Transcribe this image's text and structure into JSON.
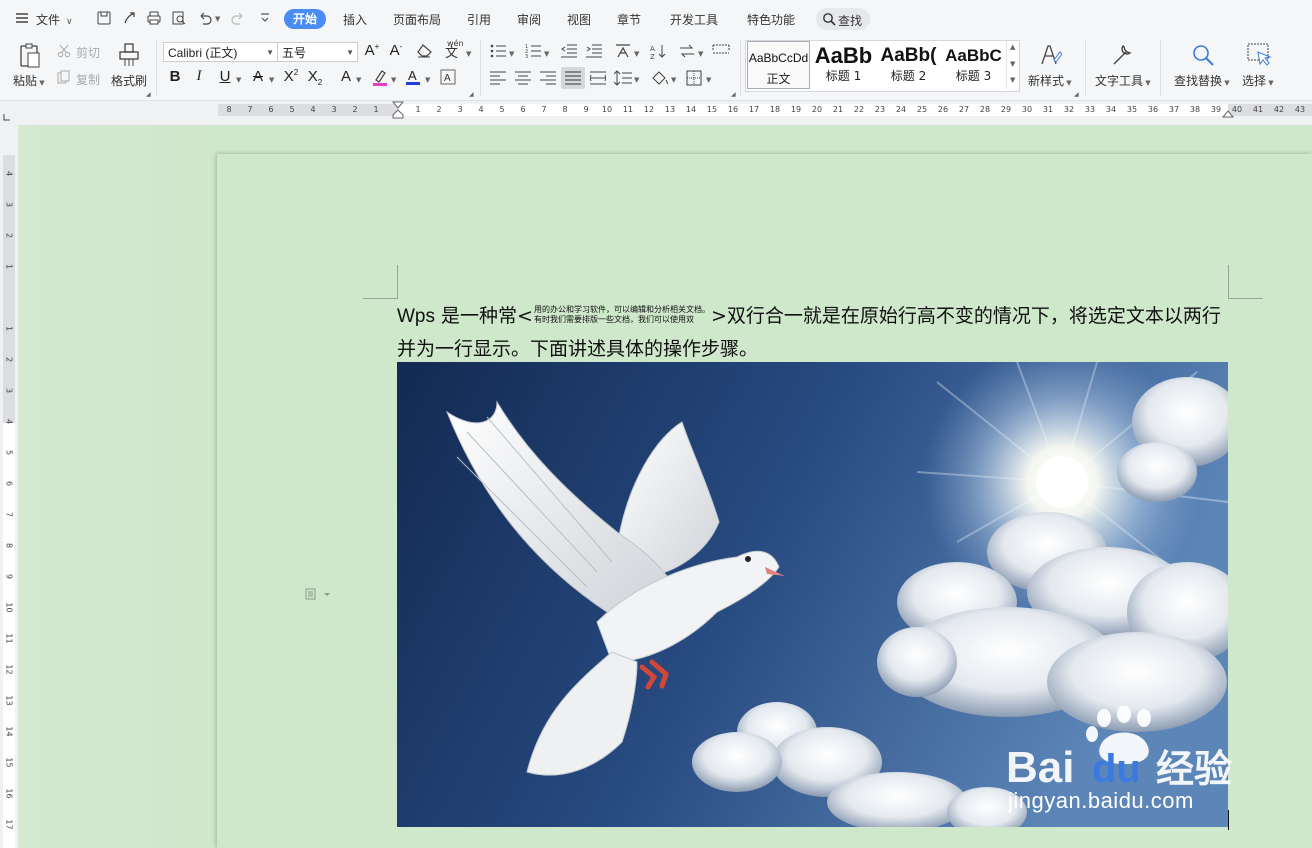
{
  "menubar": {
    "file_label": "文件",
    "tabs": [
      {
        "id": "home",
        "label": "开始",
        "active": true
      },
      {
        "id": "insert",
        "label": "插入"
      },
      {
        "id": "layout",
        "label": "页面布局"
      },
      {
        "id": "references",
        "label": "引用"
      },
      {
        "id": "review",
        "label": "审阅"
      },
      {
        "id": "view",
        "label": "视图"
      },
      {
        "id": "chapter",
        "label": "章节"
      },
      {
        "id": "dev",
        "label": "开发工具"
      },
      {
        "id": "special",
        "label": "特色功能"
      }
    ],
    "search_label": "查找",
    "accent": "#4a8cf3"
  },
  "ribbon": {
    "paste": "粘贴",
    "cut": "剪切",
    "copy": "复制",
    "format_painter": "格式刷",
    "font_name": "Calibri (正文)",
    "font_size": "五号",
    "styles": [
      {
        "preview": "AaBbCcDd",
        "name": "正文"
      },
      {
        "preview": "AaBb",
        "name": "标题 1"
      },
      {
        "preview": "AaBb(",
        "name": "标题 2"
      },
      {
        "preview": "AaBbC",
        "name": "标题 3"
      }
    ],
    "new_style": "新样式",
    "text_tools": "文字工具",
    "find_replace": "查找替换",
    "select": "选择"
  },
  "ruler": {
    "h_numbers": [
      "8",
      "7",
      "6",
      "5",
      "4",
      "3",
      "2",
      "1",
      "",
      "1",
      "2",
      "3",
      "4",
      "5",
      "6",
      "7",
      "8",
      "9",
      "10",
      "11",
      "12",
      "13",
      "14",
      "15",
      "16",
      "17",
      "18",
      "19",
      "20",
      "21",
      "22",
      "23",
      "24",
      "25",
      "26",
      "27",
      "28",
      "29",
      "30",
      "31",
      "32",
      "33",
      "34",
      "35",
      "36",
      "37",
      "38",
      "39",
      "40",
      "41",
      "42",
      "43"
    ],
    "v_numbers": [
      "4",
      "3",
      "2",
      "1",
      "",
      "1",
      "2",
      "3",
      "4",
      "5",
      "6",
      "7",
      "8",
      "9",
      "10",
      "11",
      "12",
      "13",
      "14",
      "15",
      "16",
      "17"
    ]
  },
  "document": {
    "lead_latin": "Wps",
    "lead_cjk": " 是一种常",
    "twoline_top": "用的办公和学习软件，可以编辑和分析相关文档。",
    "twoline_bottom": "有时我们需要排版一些文档，我们可以使用双",
    "after": "双行合一就是在原始行高不变的情况下，将选定文本以两行并为一行显示。下面讲述具体的操作步骤。",
    "bracket_open": "<",
    "bracket_close": ">"
  },
  "watermark": {
    "brand": "Bai",
    "brand2": "du",
    "cn": "经验",
    "url": "jingyan.baidu.com"
  }
}
